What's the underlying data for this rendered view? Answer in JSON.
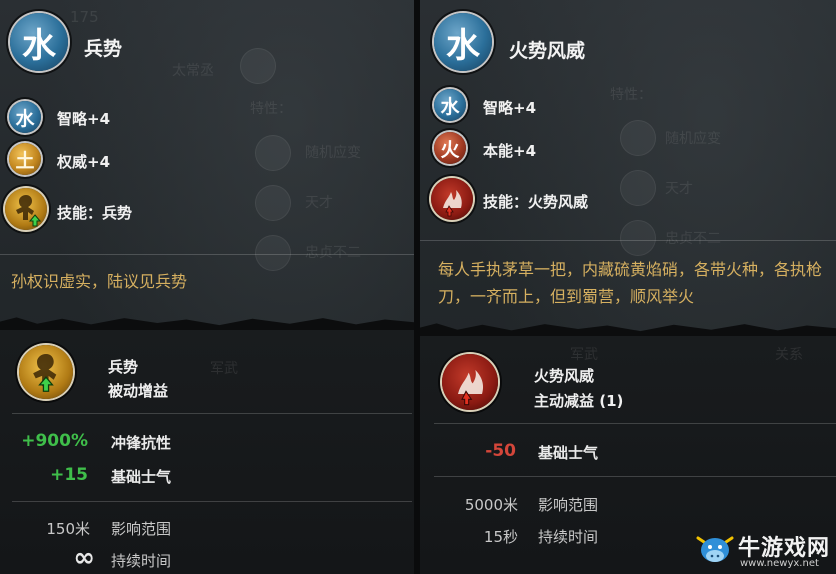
{
  "left": {
    "main_glyph": "水",
    "title": "兵势",
    "attributes": [
      {
        "glyph": "水",
        "label": "智略+4",
        "element": "water"
      },
      {
        "glyph": "土",
        "label": "权威+4",
        "element": "earth"
      }
    ],
    "skill_label": "技能：兵势",
    "quote": "孙权识虚实，陆议见兵势",
    "effect": {
      "name": "兵势",
      "type": "被动增益",
      "stats": [
        {
          "value": "+900%",
          "label": "冲锋抗性",
          "color": "green"
        },
        {
          "value": "+15",
          "label": "基础士气",
          "color": "green"
        }
      ],
      "info": [
        {
          "value": "150米",
          "label": "影响范围"
        },
        {
          "value": "∞",
          "label": "持续时间"
        }
      ]
    },
    "ghost_text": [
      "175",
      "太常丞",
      "特性：",
      "随机应变",
      "天才",
      "忠贞不二",
      "军武"
    ]
  },
  "right": {
    "main_glyph": "水",
    "title": "火势风威",
    "attributes": [
      {
        "glyph": "水",
        "label": "智略+4",
        "element": "water"
      },
      {
        "glyph": "火",
        "label": "本能+4",
        "element": "fire"
      }
    ],
    "skill_label": "技能：火势风威",
    "quote": "每人手执茅草一把，内藏硫黄焰硝，各带火种，各执枪刀，一齐而上，但到蜀营，顺风举火",
    "effect": {
      "name": "火势风威",
      "type": "主动减益 (1)",
      "stats": [
        {
          "value": "-50",
          "label": "基础士气",
          "color": "red"
        }
      ],
      "info": [
        {
          "value": "5000米",
          "label": "影响范围"
        },
        {
          "value": "15秒",
          "label": "持续时间"
        }
      ]
    },
    "ghost_text": [
      "特性：",
      "随机应变",
      "天才",
      "忠贞不二",
      "军武",
      "关系"
    ]
  },
  "watermark": {
    "name": "牛游戏网",
    "url": "www.newyx.net"
  },
  "colors": {
    "positive": "#3fbe4a",
    "negative": "#d4463a",
    "quote": "#d6b060"
  }
}
